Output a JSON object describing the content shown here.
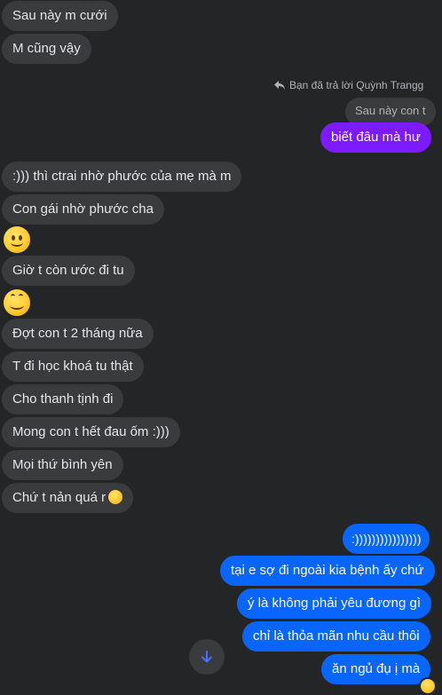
{
  "messages": {
    "m1": "Sau này m cưới",
    "m2": "M cũng vậy",
    "reply_note": "Bạn đã trả lời Quỳnh Trangg",
    "quoted": "Sau này con t",
    "reply": "biết đâu mà hư",
    "m3": ":))) thì ctrai nhờ phước của mẹ mà m",
    "m4": "Con gái nhờ phước cha",
    "m5": "Giờ t còn ước đi tu",
    "m6": "Đợt con t 2 tháng nữa",
    "m7": "T đi học khoá tu thật",
    "m8": "Cho thanh tịnh đi",
    "m9": "Mong con t hết đau ốm :)))",
    "m10": "Mọi thứ bình yên",
    "m11": "Chứ t nản quá r",
    "o1": ":))))))))))))))))",
    "o2": "tại e sợ đi ngoài kia bệnh ấy chứ",
    "o3": "ý là không phải yêu đương gì",
    "o4": "chỉ là thỏa mãn nhu cầu thôi",
    "o5": "ăn ngủ đụ ị mà"
  },
  "icons": {
    "smile": "slightly-smiling-face-icon",
    "blush": "smiling-face-with-smiling-eyes-icon",
    "reply": "reply-arrow-icon",
    "scroll": "arrow-down-icon",
    "reaction": "grinning-squinting-face-icon"
  },
  "colors": {
    "background": "#242526",
    "incoming": "#3a3b3c",
    "outgoing": "#0866ff",
    "outgoing_alt": "#7d1aff"
  }
}
